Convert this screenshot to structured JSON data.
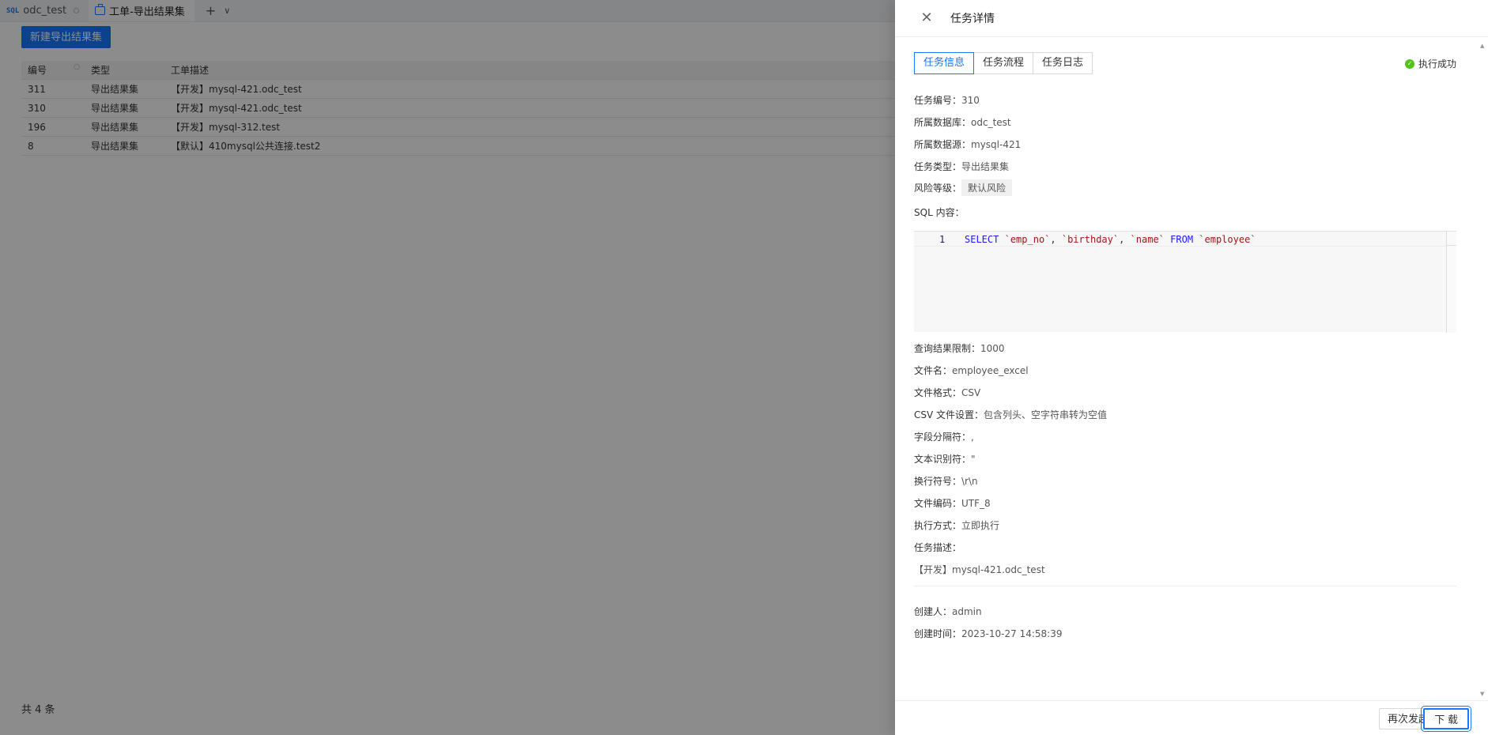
{
  "tabs": [
    {
      "badge": "SQL",
      "label": "odc_test"
    },
    {
      "label": "工单-导出结果集"
    }
  ],
  "toolbar": {
    "new_label": "新建导出结果集"
  },
  "grid": {
    "headers": [
      "编号",
      "类型",
      "工单描述"
    ],
    "rows": [
      {
        "id": "311",
        "type": "导出结果集",
        "desc": "【开发】mysql-421.odc_test"
      },
      {
        "id": "310",
        "type": "导出结果集",
        "desc": "【开发】mysql-421.odc_test"
      },
      {
        "id": "196",
        "type": "导出结果集",
        "desc": "【开发】mysql-312.test"
      },
      {
        "id": "8",
        "type": "导出结果集",
        "desc": "【默认】410mysql公共连接.test2"
      }
    ],
    "total": "共 4 条"
  },
  "drawer": {
    "title": "任务详情",
    "tabs": [
      "任务信息",
      "任务流程",
      "任务日志"
    ],
    "status": "执行成功",
    "fields": {
      "task_no": {
        "label": "任务编号：",
        "value": "310"
      },
      "database": {
        "label": "所属数据库：",
        "value": "odc_test"
      },
      "datasource": {
        "label": "所属数据源：",
        "value": "mysql-421"
      },
      "task_type": {
        "label": "任务类型：",
        "value": "导出结果集"
      },
      "risk": {
        "label": "风险等级：",
        "value": "默认风险"
      },
      "sql": {
        "label": "SQL 内容："
      },
      "limit": {
        "label": "查询结果限制：",
        "value": "1000"
      },
      "filename": {
        "label": "文件名：",
        "value": "employee_excel"
      },
      "format": {
        "label": "文件格式：",
        "value": "CSV"
      },
      "csv_settings": {
        "label": "CSV 文件设置：",
        "value": "包含列头、空字符串转为空值"
      },
      "field_sep": {
        "label": "字段分隔符：",
        "value": ","
      },
      "text_qual": {
        "label": "文本识别符：",
        "value": "\""
      },
      "line_sep": {
        "label": "换行符号：",
        "value": "\\r\\n"
      },
      "encoding": {
        "label": "文件编码：",
        "value": "UTF_8"
      },
      "exec_mode": {
        "label": "执行方式：",
        "value": "立即执行"
      },
      "desc": {
        "label": "任务描述：",
        "value": "【开发】mysql-421.odc_test"
      },
      "creator": {
        "label": "创建人：",
        "value": "admin"
      },
      "created_at": {
        "label": "创建时间：",
        "value": "2023-10-27 14:58:39"
      }
    },
    "sql_editor": {
      "line_no": "1",
      "tokens": {
        "select": "SELECT",
        "c1": "`emp_no`",
        "sep1": ", ",
        "c2": "`birthday`",
        "sep2": ", ",
        "c3": "`name`",
        "from": "FROM",
        "table": "`employee`"
      }
    },
    "footer": {
      "retry_label": "再次发起",
      "download_label": "下 载"
    }
  }
}
